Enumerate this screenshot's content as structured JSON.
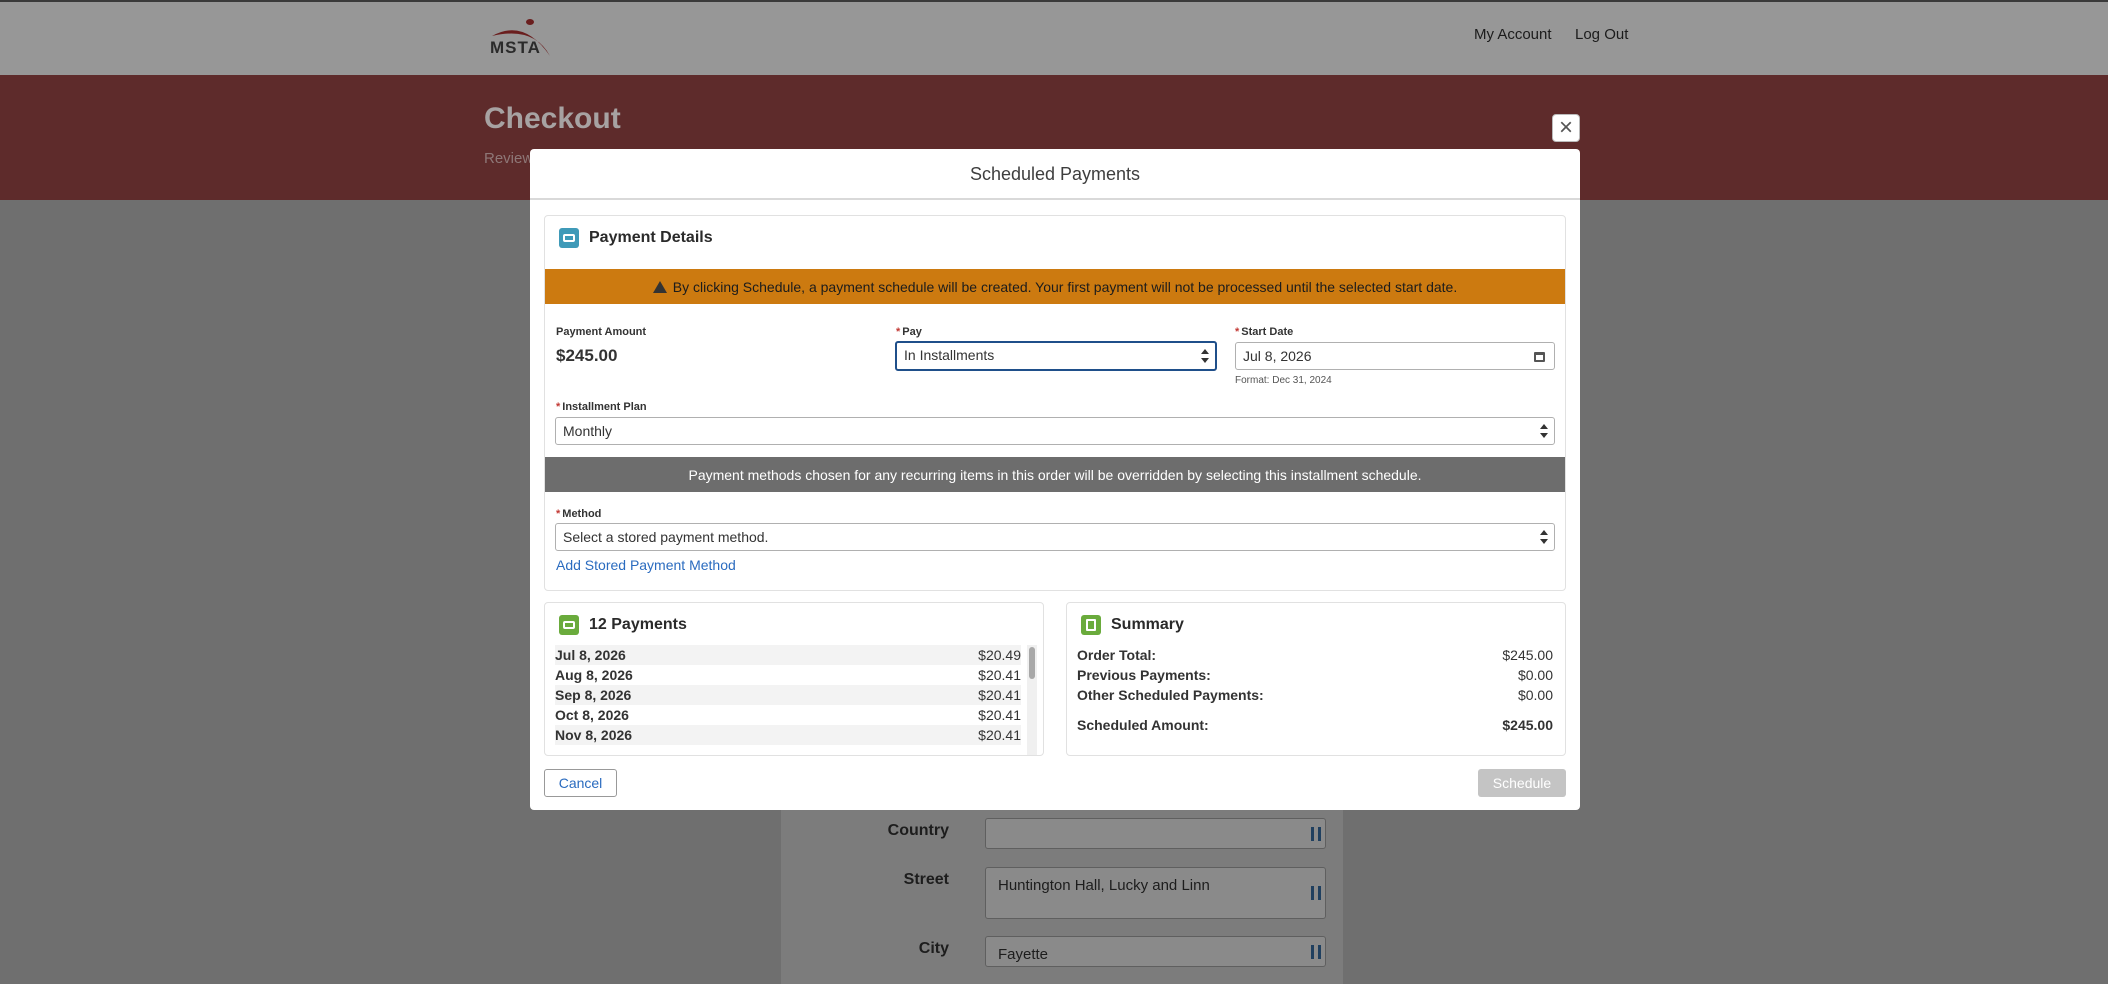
{
  "header": {
    "logo_text": "MSTA",
    "nav": [
      {
        "label": "My Account"
      },
      {
        "label": "Log Out"
      }
    ]
  },
  "banner": {
    "title": "Checkout",
    "subtitle": "Review"
  },
  "background_form": {
    "fields": [
      {
        "label": "Country",
        "value": ""
      },
      {
        "label": "Street",
        "value": "Huntington Hall, Lucky and Linn"
      },
      {
        "label": "City",
        "value": "Fayette"
      }
    ]
  },
  "modal": {
    "title": "Scheduled Payments",
    "payment_details": {
      "heading": "Payment Details",
      "warning": "By clicking Schedule, a payment schedule will be created. Your first payment will not be processed until the selected start date.",
      "payment_amount_label": "Payment Amount",
      "payment_amount": "$245.00",
      "pay_label": "Pay",
      "pay_value": "In Installments",
      "start_date_label": "Start Date",
      "start_date_value": "Jul 8, 2026",
      "start_date_format": "Format: Dec 31, 2024",
      "installment_plan_label": "Installment Plan",
      "installment_plan_value": "Monthly",
      "info": "Payment methods chosen for any recurring items in this order will be overridden by selecting this installment schedule.",
      "method_label": "Method",
      "method_placeholder": "Select a stored payment method.",
      "add_method_link": "Add Stored Payment Method",
      "required_mark": "*"
    },
    "payments": {
      "heading": "12 Payments",
      "rows": [
        {
          "date": "Jul 8, 2026",
          "amount": "$20.49"
        },
        {
          "date": "Aug 8, 2026",
          "amount": "$20.41"
        },
        {
          "date": "Sep 8, 2026",
          "amount": "$20.41"
        },
        {
          "date": "Oct 8, 2026",
          "amount": "$20.41"
        },
        {
          "date": "Nov 8, 2026",
          "amount": "$20.41"
        }
      ]
    },
    "summary": {
      "heading": "Summary",
      "rows": [
        {
          "label": "Order Total:",
          "value": "$245.00"
        },
        {
          "label": "Previous Payments:",
          "value": "$0.00"
        },
        {
          "label": "Other Scheduled Payments:",
          "value": "$0.00"
        },
        {
          "label": "Scheduled Amount:",
          "value": "$245.00"
        }
      ]
    },
    "buttons": {
      "cancel": "Cancel",
      "schedule": "Schedule"
    },
    "close_glyph": "×"
  },
  "colors": {
    "warning": "#cc7a10",
    "info": "#6d6d6d",
    "link": "#2a6bbf",
    "banner": "#5e2b2b",
    "required": "#c23934"
  }
}
